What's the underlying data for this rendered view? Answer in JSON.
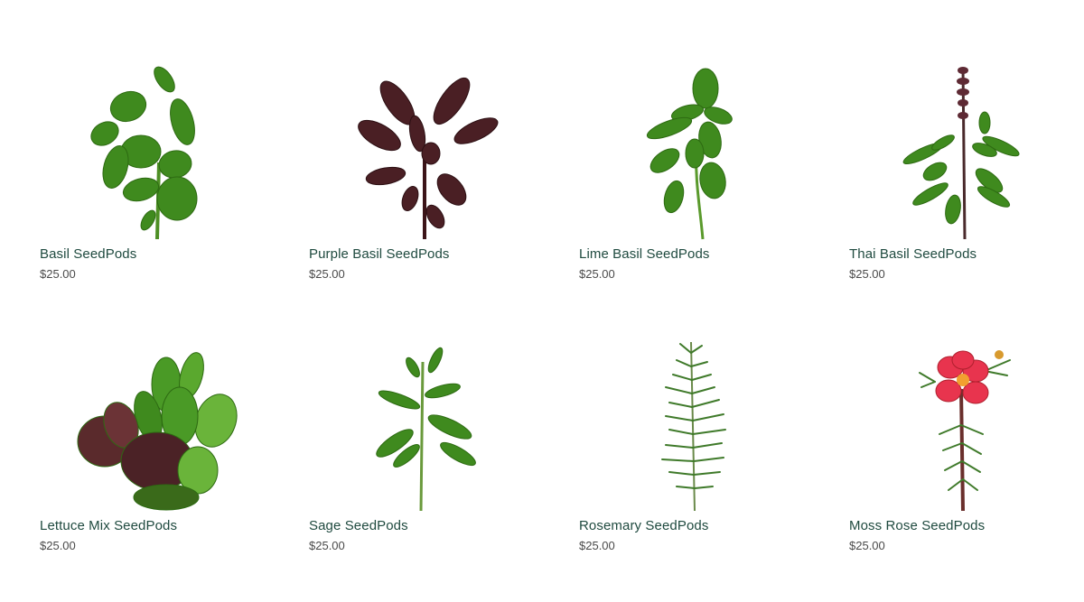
{
  "products": [
    {
      "name": "Basil SeedPods",
      "price": "$25.00",
      "icon": "basil-plant-icon"
    },
    {
      "name": "Purple Basil SeedPods",
      "price": "$25.00",
      "icon": "purple-basil-plant-icon"
    },
    {
      "name": "Lime Basil SeedPods",
      "price": "$25.00",
      "icon": "lime-basil-plant-icon"
    },
    {
      "name": "Thai Basil SeedPods",
      "price": "$25.00",
      "icon": "thai-basil-plant-icon"
    },
    {
      "name": "Lettuce Mix SeedPods",
      "price": "$25.00",
      "icon": "lettuce-mix-plant-icon"
    },
    {
      "name": "Sage SeedPods",
      "price": "$25.00",
      "icon": "sage-plant-icon"
    },
    {
      "name": "Rosemary SeedPods",
      "price": "$25.00",
      "icon": "rosemary-plant-icon"
    },
    {
      "name": "Moss Rose SeedPods",
      "price": "$25.00",
      "icon": "moss-rose-plant-icon"
    }
  ],
  "colors": {
    "name_text": "#1f4a3f",
    "price_text": "#4a4a4a",
    "leaf_green": "#3f8a1e",
    "leaf_purple": "#4a1f24",
    "flower_pink": "#e8344e"
  }
}
